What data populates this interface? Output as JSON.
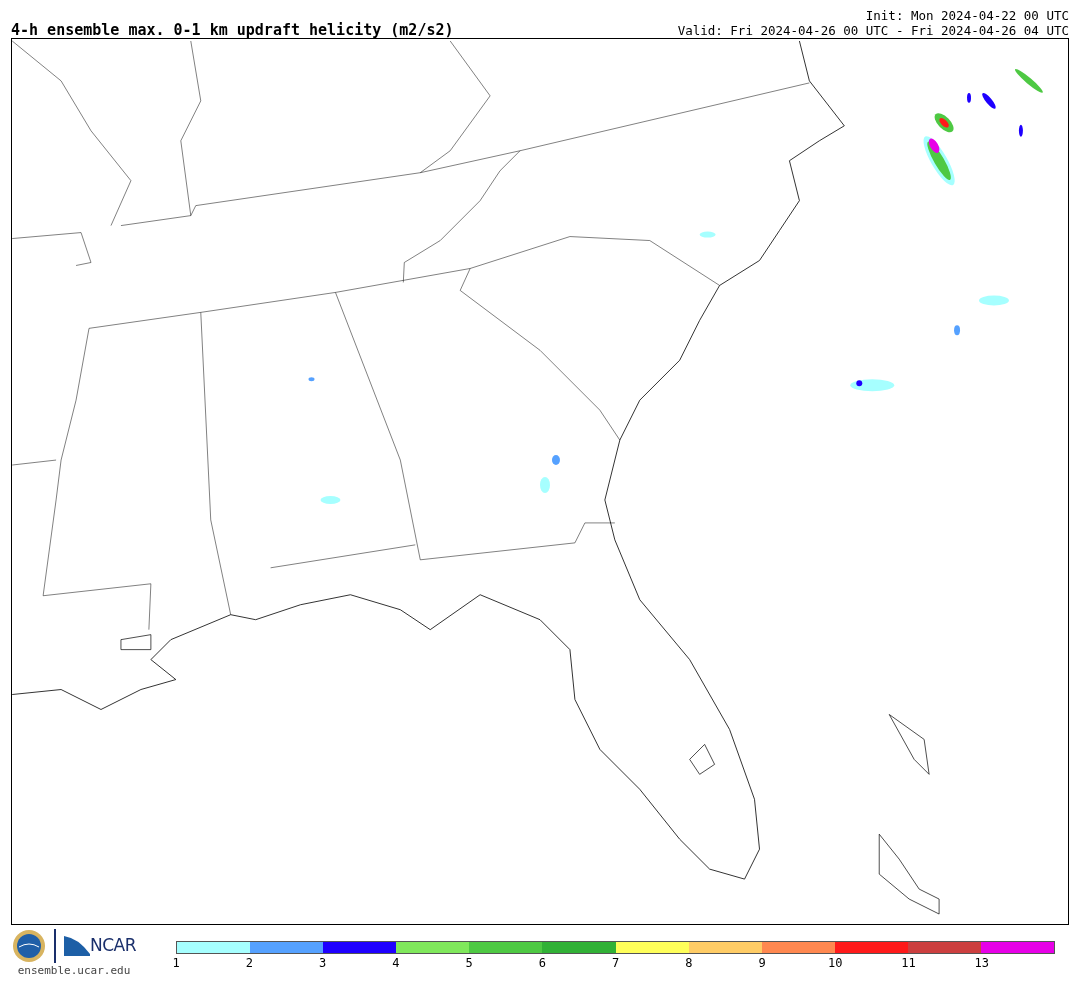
{
  "title": "4-h ensemble max. 0-1 km updraft helicity (m2/s2)",
  "init": "Init: Mon 2024-04-22 00 UTC",
  "valid": "Valid: Fri 2024-04-26 00 UTC - Fri 2024-04-26 04 UTC",
  "footer": {
    "logo_text": "NCAR",
    "website": "ensemble.ucar.edu"
  },
  "colorbar": [
    {
      "label": "1",
      "color": "#a6ffff"
    },
    {
      "label": "2",
      "color": "#55a1ff"
    },
    {
      "label": "3",
      "color": "#1e00ff"
    },
    {
      "label": "4",
      "color": "#80e85c"
    },
    {
      "label": "5",
      "color": "#4ec943"
    },
    {
      "label": "6",
      "color": "#31b136"
    },
    {
      "label": "7",
      "color": "#ffff5a"
    },
    {
      "label": "8",
      "color": "#ffcc66"
    },
    {
      "label": "9",
      "color": "#ff8850"
    },
    {
      "label": "10",
      "color": "#ff1a1a"
    },
    {
      "label": "11",
      "color": "#cc3f3f"
    },
    {
      "label": "13",
      "color": "#e700e7"
    }
  ]
}
